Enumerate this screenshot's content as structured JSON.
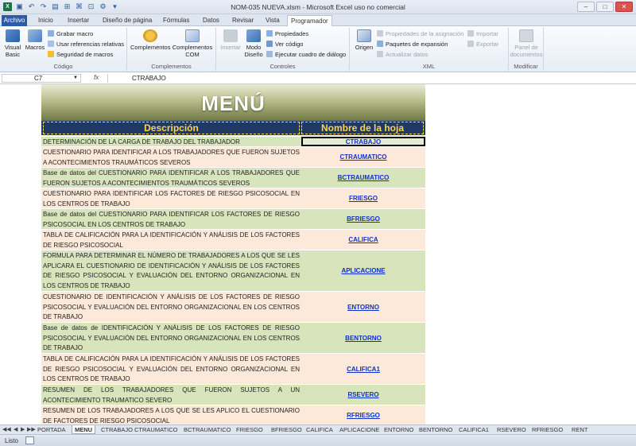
{
  "window": {
    "title": "NOM-035 NUEVA.xlsm - Microsoft Excel uso no comercial"
  },
  "ribbon_tabs": [
    "Archivo",
    "Inicio",
    "Insertar",
    "Diseño de página",
    "Fórmulas",
    "Datos",
    "Revisar",
    "Vista",
    "Programador"
  ],
  "active_tab": "Programador",
  "ribbon": {
    "codigo": {
      "label": "Código",
      "visual_basic": "Visual Basic",
      "macros": "Macros",
      "grabar_macro": "Grabar macro",
      "usar_referencias": "Usar referencias relativas",
      "seguridad": "Seguridad de macros"
    },
    "complementos": {
      "label": "Complementos",
      "complementos": "Complementos",
      "complementos_com": "Complementos COM"
    },
    "controles": {
      "label": "Controles",
      "insertar": "Insertar",
      "modo_diseno": "Modo Diseño",
      "propiedades": "Propiedades",
      "ver_codigo": "Ver código",
      "ejecutar_cuadro": "Ejecutar cuadro de diálogo"
    },
    "xml": {
      "label": "XML",
      "origen": "Origen",
      "propiedades_asignacion": "Propiedades de la asignación",
      "paquetes_expansion": "Paquetes de expansión",
      "actualizar_datos": "Actualizar datos",
      "importar": "Importar",
      "exportar": "Exportar"
    },
    "modificar": {
      "label": "Modificar",
      "panel_documentos": "Panel de documentos"
    }
  },
  "formula_bar": {
    "name_box": "C7",
    "fx": "fx",
    "value": "CTRABAJO"
  },
  "menu": {
    "title": "MENÚ",
    "col_desc": "Descripción",
    "col_sheet": "Nombre de la hoja",
    "rows": [
      {
        "desc": "DETERMINACIÓN DE LA CARGA DE TRABAJO DEL TRABAJADOR",
        "sheet": "CTRABAJO"
      },
      {
        "desc": "CUESTIONARIO PARA IDENTIFICAR A LOS TRABAJADORES QUE FUERON SUJETOS A ACONTECIMIENTOS TRAUMÁTICOS SEVEROS",
        "sheet": "CTRAUMATICO"
      },
      {
        "desc": "Base de datos del CUESTIONARIO PARA IDENTIFICAR A LOS TRABAJADORES QUE FUERON SUJETOS A ACONTECIMIENTOS TRAUMÁTICOS SEVEROS",
        "sheet": "BCTRAUMATICO"
      },
      {
        "desc": "CUESTIONARIO PARA IDENTIFICAR LOS FACTORES DE RIESGO PSICOSOCIAL EN LOS CENTROS DE TRABAJO",
        "sheet": "FRIESGO"
      },
      {
        "desc": "Base de datos del CUESTIONARIO PARA IDENTIFICAR LOS FACTORES DE RIESGO PSICOSOCIAL EN LOS CENTROS DE TRABAJO",
        "sheet": "BFRIESGO"
      },
      {
        "desc": "TABLA DE CALIFICACIÓN PARA LA IDENTIFICACIÓN Y ANÁLISIS DE LOS FACTORES DE RIESGO PSICOSOCIAL",
        "sheet": "CALIFICA"
      },
      {
        "desc": "FORMULA PARA DETERMINAR EL NÚMERO DE TRABAJADORES A LOS QUE SE LES APLICARA EL CUESTIONARIO DE IDENTIFICACIÓN Y ANÁLISIS DE LOS FACTORES DE RIESGO PSICOSOCIAL Y EVALUACIÓN DEL ENTORNO ORGANIZACIONAL EN LOS CENTROS DE TRABAJO",
        "sheet": "APLICACIONE"
      },
      {
        "desc": "CUESTIONARIO DE IDENTIFICACIÓN Y ANÁLISIS DE LOS FACTORES DE RIESGO PSICOSOCIAL Y EVALUACIÓN DEL ENTORNO ORGANIZACIONAL EN LOS CENTROS DE TRABAJO",
        "sheet": "ENTORNO"
      },
      {
        "desc": "Base de datos de IDENTIFICACIÓN Y ANÁLISIS DE LOS FACTORES DE RIESGO PSICOSOCIAL Y EVALUACIÓN DEL ENTORNO ORGANIZACIONAL EN LOS CENTROS DE TRABAJO",
        "sheet": "BENTORNO"
      },
      {
        "desc": "TABLA DE CALIFICACIÓN PARA LA IDENTIFICACIÓN Y ANÁLISIS DE LOS FACTORES DE RIESGO PSICOSOCIAL Y EVALUACIÓN DEL ENTORNO ORGANIZACIONAL EN LOS CENTROS DE TRABAJO",
        "sheet": "CALIFICA1"
      },
      {
        "desc": "RESUMEN DE LOS TRABAJADORES QUE FUERON SUJETOS A UN ACONTECIMIENTO TRAUMATICO SEVERO",
        "sheet": "RSEVERO"
      },
      {
        "desc": "RESUMEN DE LOS TRABAJADORES A LOS QUE SE LES APLICO EL CUESTIONARIO DE FACTORES DE RIESGO PSICOSOCIAL",
        "sheet": "RFRIESGO"
      }
    ]
  },
  "sheet_tabs": [
    "PORTADA",
    "MENU",
    "CTRABAJO",
    "CTRAUMATICO",
    "BCTRAUMATICO",
    "FRIESGO",
    "BFRIESGO",
    "CALIFICA",
    "APLICACIONE",
    "ENTORNO",
    "BENTORNO",
    "CALIFICA1",
    "RSEVERO",
    "RFRIESGO",
    "RENT"
  ],
  "active_sheet": "MENU",
  "status": {
    "ready": "Listo"
  }
}
